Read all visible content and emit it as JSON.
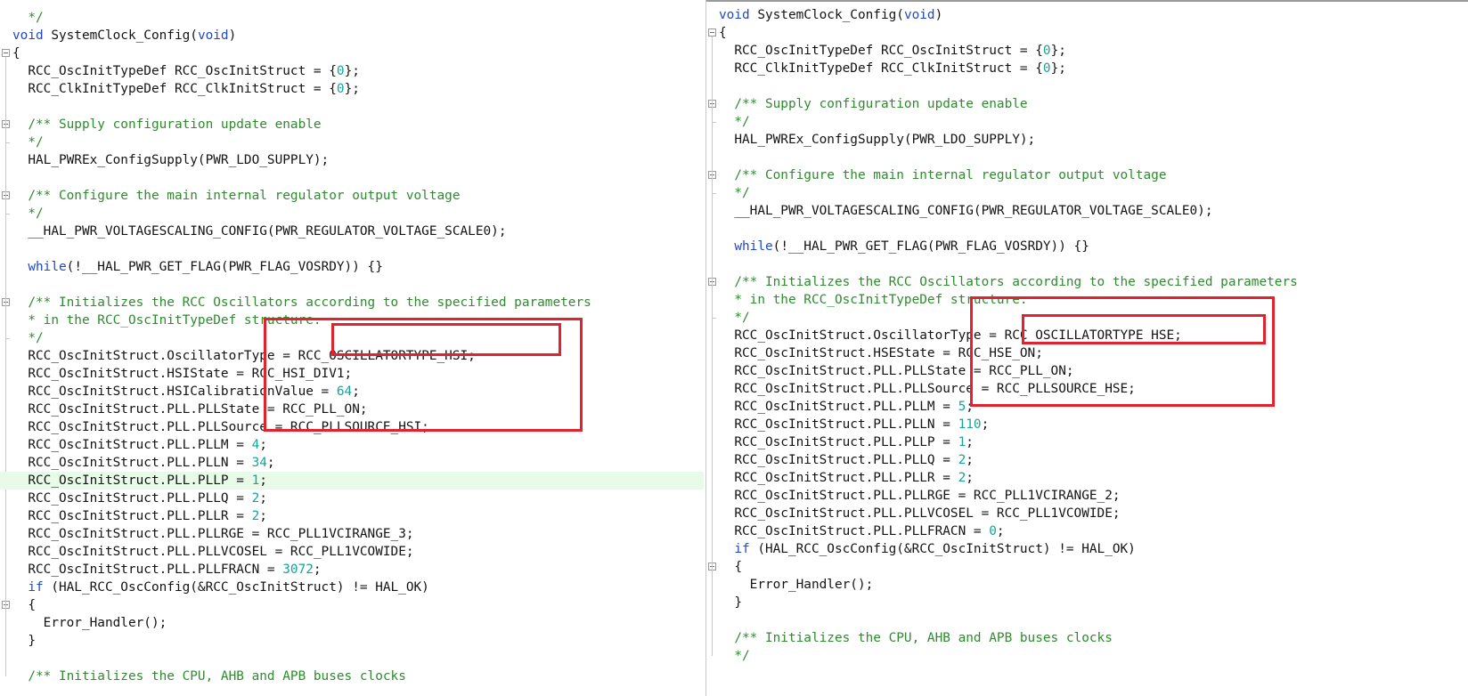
{
  "colors": {
    "comment": "#2e8b2e",
    "keyword": "#1f49c8",
    "number": "#16a39a",
    "text": "#141414",
    "highlight_line": "#e8fbe8",
    "annotation_box": "#e0232e"
  },
  "panes": [
    {
      "id": "left",
      "highlighted_line": "RCC_OscInitStruct.PLL.PLLP = 1;",
      "lines": [
        [
          {
            "t": "  */",
            "c": "comment"
          }
        ],
        [
          {
            "t": "void",
            "c": "keyword"
          },
          {
            "t": " SystemClock_Config("
          },
          {
            "t": "void",
            "c": "keyword"
          },
          {
            "t": ")"
          }
        ],
        [
          {
            "t": "{"
          }
        ],
        [
          {
            "t": "  RCC_OscInitTypeDef RCC_OscInitStruct = {"
          },
          {
            "t": "0",
            "c": "number"
          },
          {
            "t": "};"
          }
        ],
        [
          {
            "t": "  RCC_ClkInitTypeDef RCC_ClkInitStruct = {"
          },
          {
            "t": "0",
            "c": "number"
          },
          {
            "t": "};"
          }
        ],
        [],
        [
          {
            "t": "  /** Supply configuration update enable",
            "c": "comment"
          }
        ],
        [
          {
            "t": "  */",
            "c": "comment"
          }
        ],
        [
          {
            "t": "  HAL_PWREx_ConfigSupply(PWR_LDO_SUPPLY);"
          }
        ],
        [],
        [
          {
            "t": "  /** Configure the main internal regulator output voltage",
            "c": "comment"
          }
        ],
        [
          {
            "t": "  */",
            "c": "comment"
          }
        ],
        [
          {
            "t": "  __HAL_PWR_VOLTAGESCALING_CONFIG(PWR_REGULATOR_VOLTAGE_SCALE0);"
          }
        ],
        [],
        [
          {
            "t": "  "
          },
          {
            "t": "while",
            "c": "keyword"
          },
          {
            "t": "(!__HAL_PWR_GET_FLAG(PWR_FLAG_VOSRDY)) {}"
          }
        ],
        [],
        [
          {
            "t": "  /** Initializes the RCC Oscillators according to the specified parameters",
            "c": "comment"
          }
        ],
        [
          {
            "t": "  * in the RCC_OscInitTypeDef structure.",
            "c": "comment"
          }
        ],
        [
          {
            "t": "  */",
            "c": "comment"
          }
        ],
        [
          {
            "t": "  RCC_OscInitStruct.OscillatorType = RCC_OSCILLATORTYPE_HSI;"
          }
        ],
        [
          {
            "t": "  RCC_OscInitStruct.HSIState = RCC_HSI_DIV1;"
          }
        ],
        [
          {
            "t": "  RCC_OscInitStruct.HSICalibrationValue = "
          },
          {
            "t": "64",
            "c": "number"
          },
          {
            "t": ";"
          }
        ],
        [
          {
            "t": "  RCC_OscInitStruct.PLL.PLLState = RCC_PLL_ON;"
          }
        ],
        [
          {
            "t": "  RCC_OscInitStruct.PLL.PLLSource = RCC_PLLSOURCE_HSI;"
          }
        ],
        [
          {
            "t": "  RCC_OscInitStruct.PLL.PLLM = "
          },
          {
            "t": "4",
            "c": "number"
          },
          {
            "t": ";"
          }
        ],
        [
          {
            "t": "  RCC_OscInitStruct.PLL.PLLN = "
          },
          {
            "t": "34",
            "c": "number"
          },
          {
            "t": ";"
          }
        ],
        [
          {
            "t": "  RCC_OscInitStruct.PLL.PLLP = "
          },
          {
            "t": "1",
            "c": "number"
          },
          {
            "t": ";"
          }
        ],
        [
          {
            "t": "  RCC_OscInitStruct.PLL.PLLQ = "
          },
          {
            "t": "2",
            "c": "number"
          },
          {
            "t": ";"
          }
        ],
        [
          {
            "t": "  RCC_OscInitStruct.PLL.PLLR = "
          },
          {
            "t": "2",
            "c": "number"
          },
          {
            "t": ";"
          }
        ],
        [
          {
            "t": "  RCC_OscInitStruct.PLL.PLLRGE = RCC_PLL1VCIRANGE_3;"
          }
        ],
        [
          {
            "t": "  RCC_OscInitStruct.PLL.PLLVCOSEL = RCC_PLL1VCOWIDE;"
          }
        ],
        [
          {
            "t": "  RCC_OscInitStruct.PLL.PLLFRACN = "
          },
          {
            "t": "3072",
            "c": "number"
          },
          {
            "t": ";"
          }
        ],
        [
          {
            "t": "  "
          },
          {
            "t": "if",
            "c": "keyword"
          },
          {
            "t": " (HAL_RCC_OscConfig(&RCC_OscInitStruct) != HAL_OK)"
          }
        ],
        [
          {
            "t": "  {"
          }
        ],
        [
          {
            "t": "    Error_Handler();"
          }
        ],
        [
          {
            "t": "  }"
          }
        ],
        [],
        [
          {
            "t": "  /** Initializes the CPU, AHB and APB buses clocks",
            "c": "comment"
          }
        ]
      ]
    },
    {
      "id": "right",
      "lines": [
        [
          {
            "t": "void",
            "c": "keyword"
          },
          {
            "t": " SystemClock_Config("
          },
          {
            "t": "void",
            "c": "keyword"
          },
          {
            "t": ")"
          }
        ],
        [
          {
            "t": "{"
          }
        ],
        [
          {
            "t": "  RCC_OscInitTypeDef RCC_OscInitStruct = {"
          },
          {
            "t": "0",
            "c": "number"
          },
          {
            "t": "};"
          }
        ],
        [
          {
            "t": "  RCC_ClkInitTypeDef RCC_ClkInitStruct = {"
          },
          {
            "t": "0",
            "c": "number"
          },
          {
            "t": "};"
          }
        ],
        [],
        [
          {
            "t": "  /** Supply configuration update enable",
            "c": "comment"
          }
        ],
        [
          {
            "t": "  */",
            "c": "comment"
          }
        ],
        [
          {
            "t": "  HAL_PWREx_ConfigSupply(PWR_LDO_SUPPLY);"
          }
        ],
        [],
        [
          {
            "t": "  /** Configure the main internal regulator output voltage",
            "c": "comment"
          }
        ],
        [
          {
            "t": "  */",
            "c": "comment"
          }
        ],
        [
          {
            "t": "  __HAL_PWR_VOLTAGESCALING_CONFIG(PWR_REGULATOR_VOLTAGE_SCALE0);"
          }
        ],
        [],
        [
          {
            "t": "  "
          },
          {
            "t": "while",
            "c": "keyword"
          },
          {
            "t": "(!__HAL_PWR_GET_FLAG(PWR_FLAG_VOSRDY)) {}"
          }
        ],
        [],
        [
          {
            "t": "  /** Initializes the RCC Oscillators according to the specified parameters",
            "c": "comment"
          }
        ],
        [
          {
            "t": "  * in the RCC_OscInitTypeDef structure.",
            "c": "comment"
          }
        ],
        [
          {
            "t": "  */",
            "c": "comment"
          }
        ],
        [
          {
            "t": "  RCC_OscInitStruct.OscillatorType = RCC_OSCILLATORTYPE_HSE;"
          }
        ],
        [
          {
            "t": "  RCC_OscInitStruct.HSEState = RCC_HSE_ON;"
          }
        ],
        [
          {
            "t": "  RCC_OscInitStruct.PLL.PLLState = RCC_PLL_ON;"
          }
        ],
        [
          {
            "t": "  RCC_OscInitStruct.PLL.PLLSource = RCC_PLLSOURCE_HSE;"
          }
        ],
        [
          {
            "t": "  RCC_OscInitStruct.PLL.PLLM = "
          },
          {
            "t": "5",
            "c": "number"
          },
          {
            "t": ";"
          }
        ],
        [
          {
            "t": "  RCC_OscInitStruct.PLL.PLLN = "
          },
          {
            "t": "110",
            "c": "number"
          },
          {
            "t": ";"
          }
        ],
        [
          {
            "t": "  RCC_OscInitStruct.PLL.PLLP = "
          },
          {
            "t": "1",
            "c": "number"
          },
          {
            "t": ";"
          }
        ],
        [
          {
            "t": "  RCC_OscInitStruct.PLL.PLLQ = "
          },
          {
            "t": "2",
            "c": "number"
          },
          {
            "t": ";"
          }
        ],
        [
          {
            "t": "  RCC_OscInitStruct.PLL.PLLR = "
          },
          {
            "t": "2",
            "c": "number"
          },
          {
            "t": ";"
          }
        ],
        [
          {
            "t": "  RCC_OscInitStruct.PLL.PLLRGE = RCC_PLL1VCIRANGE_2;"
          }
        ],
        [
          {
            "t": "  RCC_OscInitStruct.PLL.PLLVCOSEL = RCC_PLL1VCOWIDE;"
          }
        ],
        [
          {
            "t": "  RCC_OscInitStruct.PLL.PLLFRACN = "
          },
          {
            "t": "0",
            "c": "number"
          },
          {
            "t": ";"
          }
        ],
        [
          {
            "t": "  "
          },
          {
            "t": "if",
            "c": "keyword"
          },
          {
            "t": " (HAL_RCC_OscConfig(&RCC_OscInitStruct) != HAL_OK)"
          }
        ],
        [
          {
            "t": "  {"
          }
        ],
        [
          {
            "t": "    Error_Handler();"
          }
        ],
        [
          {
            "t": "  }"
          }
        ],
        [],
        [
          {
            "t": "  /** Initializes the CPU, AHB and APB buses clocks",
            "c": "comment"
          }
        ],
        [
          {
            "t": "  */",
            "c": "comment"
          }
        ]
      ]
    }
  ]
}
